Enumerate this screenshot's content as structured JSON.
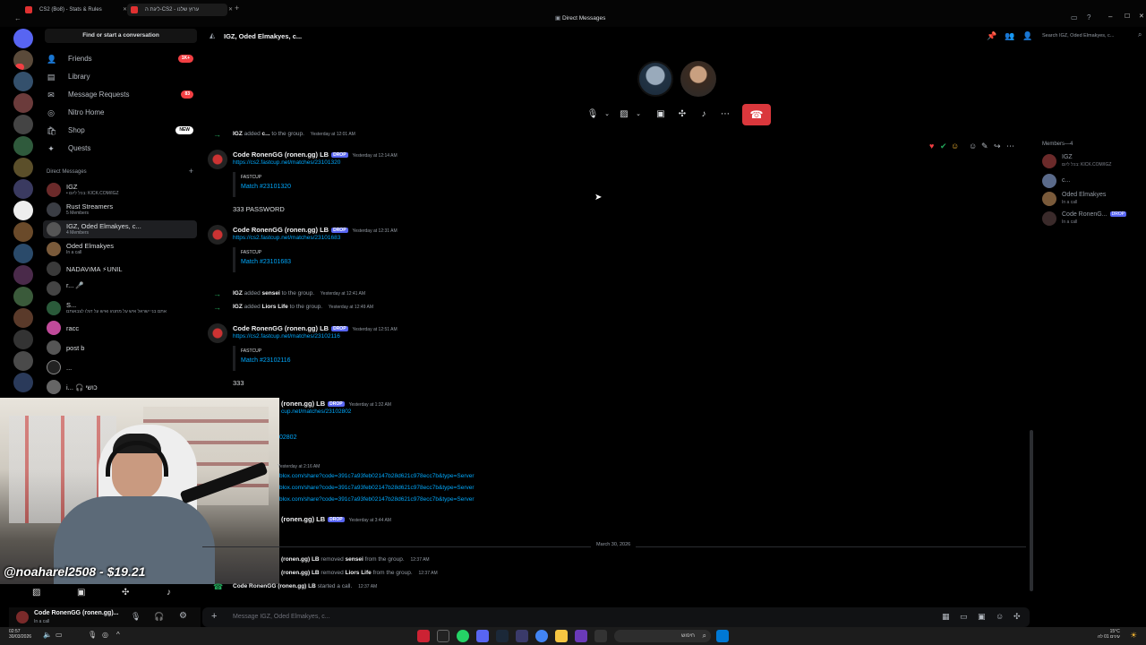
{
  "browser_tabs": [
    {
      "label": "CS2 (Bo8) - Stats & Rules"
    },
    {
      "label": "ליגת ה-CS2 - ערוץ שלנו"
    }
  ],
  "window_title": "Direct Messages",
  "sidebar": {
    "find_placeholder": "Find or start a conversation",
    "nav": [
      {
        "label": "Friends",
        "icon": "friends-icon",
        "badge": "1K+"
      },
      {
        "label": "Library",
        "icon": "library-icon",
        "badge": ""
      },
      {
        "label": "Message Requests",
        "icon": "mail-icon",
        "badge": "83"
      },
      {
        "label": "Nitro Home",
        "icon": "nitro-icon",
        "badge": ""
      },
      {
        "label": "Shop",
        "icon": "shop-icon",
        "badge": "NEW"
      },
      {
        "label": "Quests",
        "icon": "quests-icon",
        "badge": ""
      }
    ],
    "dm_header": "Direct Messages",
    "dm_plus": "+",
    "dms": [
      {
        "name": "IGZ",
        "sub": "• בכל ליום: KICK.COM/IGZ"
      },
      {
        "name": "Rust Streamers",
        "sub": "5 Members"
      },
      {
        "name": "IGZ, Oded Elmakyes, c...",
        "sub": "4 Members"
      },
      {
        "name": "Oded Elmakyes",
        "sub": "In a call"
      },
      {
        "name": "NADAVוMA ⚡UNIL",
        "sub": ""
      },
      {
        "name": "r... 🎤",
        "sub": ""
      },
      {
        "name": "S...",
        "sub": "אתם בני ישראל איש על מחנהו ואיש על דגלו לצבאותם"
      },
      {
        "name": "racc",
        "sub": ""
      },
      {
        "name": "post b",
        "sub": ""
      },
      {
        "name": "...",
        "sub": ""
      },
      {
        "name": "i... 🎧 כושי",
        "sub": ""
      }
    ]
  },
  "user_panel": {
    "name": "Code RonenGG (ronen.gg)...",
    "status": "In a call"
  },
  "webcam": {
    "overlay_text": "@noaharel2508 - $19.21"
  },
  "header": {
    "title": "IGZ, Oded Elmakyes, c...",
    "search_placeholder": "Search IGZ, Oded Elmakyes, c..."
  },
  "call": {
    "hangup_icon": "phone-hangup-icon"
  },
  "messages": [
    {
      "kind": "system",
      "text_a": "IGZ",
      "text_b": " added ",
      "text_c": "c...",
      "text_d": " to the group.",
      "time": "Yesterday at 12:01 AM"
    },
    {
      "kind": "msg",
      "user": "Code RonenGG (ronen.gg) LB",
      "tag": "DROP",
      "time": "Yesterday at 12:14 AM",
      "link": "https://cs2.fastcup.net/matches/23101320",
      "provider": "FASTCUP",
      "embed_title": "Match #23101320"
    },
    {
      "kind": "plain",
      "text": "333 PASSWORD"
    },
    {
      "kind": "msg",
      "user": "Code RonenGG (ronen.gg) LB",
      "tag": "DROP",
      "time": "Yesterday at 12:31 AM",
      "link": "https://cs2.fastcup.net/matches/23101683",
      "provider": "FASTCUP",
      "embed_title": "Match #23101683"
    },
    {
      "kind": "system",
      "text_a": "IGZ",
      "text_b": " added ",
      "text_c": "sensei",
      "text_d": " to the group.",
      "time": "Yesterday at 12:41 AM"
    },
    {
      "kind": "system",
      "text_a": "IGZ",
      "text_b": " added ",
      "text_c": "Liors Life",
      "text_d": " to the group.",
      "time": "Yesterday at 12:49 AM"
    },
    {
      "kind": "msg",
      "user": "Code RonenGG (ronen.gg) LB",
      "tag": "DROP",
      "time": "Yesterday at 12:51 AM",
      "link": "https://cs2.fastcup.net/matches/23102116",
      "provider": "FASTCUP",
      "embed_title": "Match #23102116"
    },
    {
      "kind": "plain",
      "text": "333"
    },
    {
      "kind": "partial",
      "user": "(ronen.gg) LB",
      "tag": "DROP",
      "time": "Yesterday at 1:32 AM",
      "link": "cup.net/matches/23102802",
      "embed_title": "02802"
    },
    {
      "kind": "partial_links",
      "time": "Yesterday at 2:16 AM",
      "links": [
        "blox.com/share?code=391c7a93feb02147b28d621c978ecc7b&type=Server",
        "blox.com/share?code=391c7a93feb02147b28d621c978ecc7b&type=Server",
        "blox.com/share?code=391c7a93feb02147b28d621c978ecc7b&type=Server"
      ]
    },
    {
      "kind": "partial",
      "user": "(ronen.gg) LB",
      "tag": "DROP",
      "time": "Yesterday at 3:44 AM",
      "link": "",
      "embed_title": ""
    },
    {
      "kind": "date",
      "text": "March 30, 2026"
    },
    {
      "kind": "sys2",
      "user": "(ronen.gg) LB",
      "verb": " removed ",
      "target": "sensei",
      "tail": " from the group.",
      "time": "12:37 AM"
    },
    {
      "kind": "sys2",
      "user": "(ronen.gg) LB",
      "verb": " removed ",
      "target": "Liors Life",
      "tail": " from the group.",
      "time": "12:37 AM"
    },
    {
      "kind": "call",
      "user": "Code RonenGG (ronen.gg) LB",
      "verb": " started a call.",
      "time": "12:37 AM"
    }
  ],
  "members": {
    "header": "Members—4",
    "list": [
      {
        "name": "IGZ",
        "sub": "בכל ליום: KICK.COM/IGZ"
      },
      {
        "name": "c...",
        "sub": ""
      },
      {
        "name": "Oded Elmakyes",
        "sub": "In a call"
      },
      {
        "name": "Code RonenG...",
        "tag": "DROP",
        "sub": "In a call"
      }
    ]
  },
  "composer": {
    "placeholder": "Message IGZ, Oded Elmakyes, c..."
  },
  "taskbar": {
    "search_label": "חיפוש",
    "weather": "15°C",
    "time": "02:57",
    "date": "30/03/2026",
    "date_right": "עינים 01 לה"
  },
  "colors": {
    "accent": "#5865f2",
    "danger": "#da373c",
    "link": "#00a8fc",
    "online": "#23a55a"
  }
}
